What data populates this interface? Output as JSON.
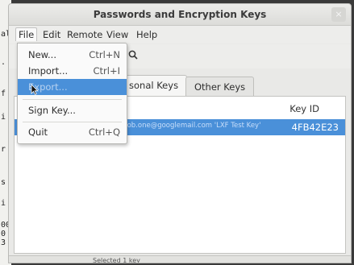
{
  "window": {
    "title": "Passwords and Encryption Keys",
    "close_glyph": "×"
  },
  "terminal": {
    "lines": [
      "al",
      ".",
      "f",
      "i",
      "r",
      "s",
      "i",
      "00",
      "0",
      "3"
    ]
  },
  "menubar": {
    "items": [
      "File",
      "Edit",
      "Remote",
      "View",
      "Help"
    ]
  },
  "tabs": {
    "personal": "sonal Keys",
    "other": "Other Keys"
  },
  "list": {
    "column_header": "Key ID",
    "row": {
      "name": "mrob.one@googlemail.com 'LXF Test Key'",
      "id": "4FB42E23"
    }
  },
  "file_menu": {
    "new": {
      "label": "New...",
      "accel": "Ctrl+N"
    },
    "import": {
      "label": "Import...",
      "accel": "Ctrl+I"
    },
    "export": {
      "label": "Export..."
    },
    "sign": {
      "label": "Sign Key..."
    },
    "quit": {
      "label": "Quit",
      "accel": "Ctrl+Q"
    }
  },
  "status": {
    "text": "Selected 1 key"
  },
  "colors": {
    "selection": "#4a90d9",
    "window_bg": "#e9e9e7"
  }
}
